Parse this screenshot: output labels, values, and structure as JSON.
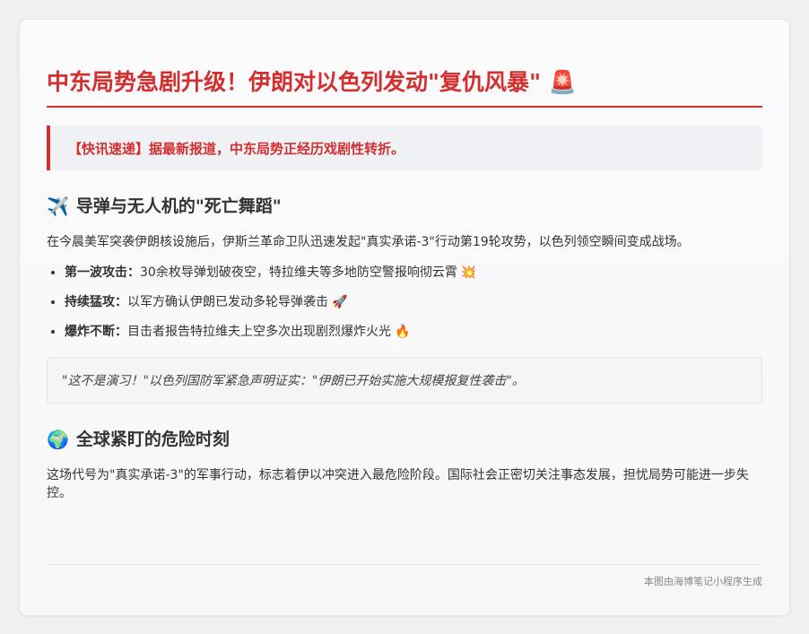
{
  "article": {
    "title": "中东局势急剧升级！伊朗对以色列发动\"复仇风暴\" 🚨",
    "flash": "【快讯速递】据最新报道，中东局势正经历戏剧性转折。",
    "section1": {
      "icon": "✈️",
      "heading": "导弹与无人机的\"死亡舞蹈\"",
      "intro": "在今晨美军突袭伊朗核设施后，伊斯兰革命卫队迅速发起\"真实承诺-3\"行动第19轮攻势，以色列领空瞬间变成战场。",
      "items": [
        {
          "label": "第一波攻击：",
          "text": "30余枚导弹划破夜空，特拉维夫等多地防空警报响彻云霄",
          "emoji": "💥"
        },
        {
          "label": "持续猛攻：",
          "text": "以军方确认伊朗已发动多轮导弹袭击",
          "emoji": "🚀"
        },
        {
          "label": "爆炸不断：",
          "text": "目击者报告特拉维夫上空多次出现剧烈爆炸火光",
          "emoji": "🔥"
        }
      ],
      "quote": "\"这不是演习！\"以色列国防军紧急声明证实：\"伊朗已开始实施大规模报复性袭击\"。"
    },
    "section2": {
      "icon": "🌍",
      "heading": "全球紧盯的危险时刻",
      "body": "这场代号为\"真实承诺-3\"的军事行动，标志着伊以冲突进入最危险阶段。国际社会正密切关注事态发展，担忧局势可能进一步失控。"
    },
    "footer": "本图由海博笔记小程序生成"
  }
}
